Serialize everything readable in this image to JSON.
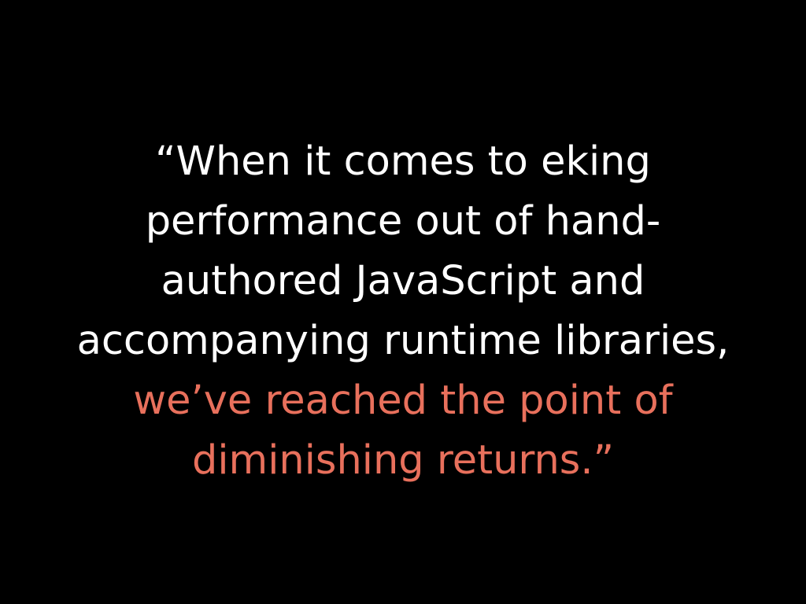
{
  "slide": {
    "colors": {
      "background": "#000000",
      "text": "#ffffff",
      "accent": "#e8705c"
    },
    "quote_lines": [
      {
        "text": "“When it comes to eking",
        "style": "white"
      },
      {
        "text": "performance out of hand-",
        "style": "white"
      },
      {
        "text": "authored JavaScript and",
        "style": "white"
      },
      {
        "text": "accompanying runtime libraries,",
        "style": "white"
      },
      {
        "text": "we’ve reached the point of",
        "style": "accent"
      },
      {
        "text": "diminishing returns.”",
        "style": "accent"
      }
    ]
  }
}
